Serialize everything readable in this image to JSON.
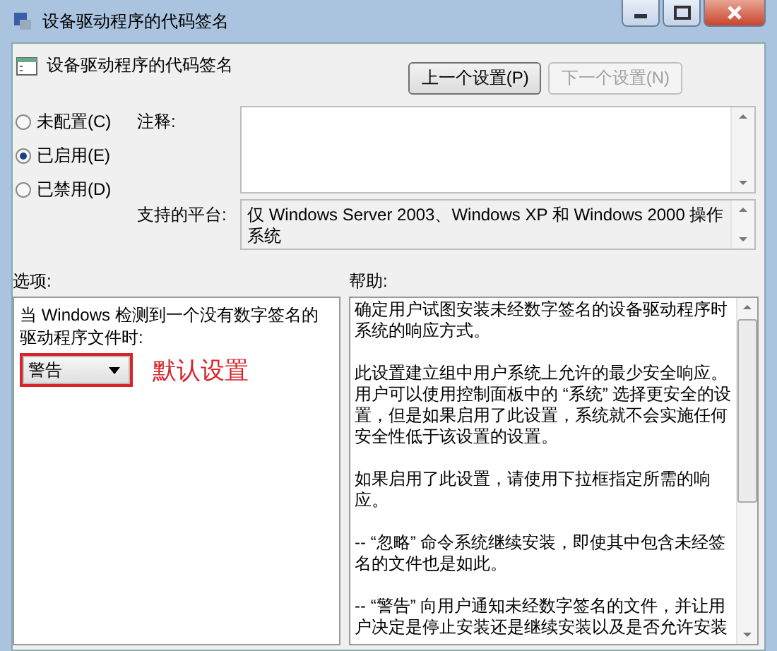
{
  "window": {
    "title": "设备驱动程序的代码签名"
  },
  "header": {
    "title": "设备驱动程序的代码签名",
    "buttons": [
      {
        "label": "上一个设置(P)",
        "disabled": false
      },
      {
        "label": "下一个设置(N)",
        "disabled": true
      }
    ]
  },
  "states": [
    {
      "label": "未配置(C)",
      "selected": false
    },
    {
      "label": "已启用(E)",
      "selected": true
    },
    {
      "label": "已禁用(D)",
      "selected": false
    }
  ],
  "comment": {
    "label": "注释:"
  },
  "platform": {
    "label": "支持的平台:",
    "value": "仅 Windows Server 2003、Windows XP 和 Windows 2000 操作系统"
  },
  "options": {
    "label": "选项:",
    "prompt": "当 Windows 检测到一个没有数字签名的驱动程序文件时:",
    "dropdown": {
      "value": "警告",
      "highlighted": true
    },
    "annotation": "默认设置"
  },
  "help": {
    "label": "帮助:",
    "paragraphs": [
      "确定用户试图安装未经数字签名的设备驱动程序时系统的响应方式。",
      "此设置建立组中用户系统上允许的最少安全响应。用户可以使用控制面板中的 “系统” 选择更安全的设置，但是如果启用了此设置，系统就不会实施任何安全性低于该设置的设置。",
      "如果启用了此设置，请使用下拉框指定所需的响应。",
      "-- “忽略” 命令系统继续安装，即使其中包含未经签名的文件也是如此。",
      "-- “警告” 向用户通知未经数字签名的文件，并让用户决定是停止安装还是继续安装以及是否允许安装"
    ]
  }
}
